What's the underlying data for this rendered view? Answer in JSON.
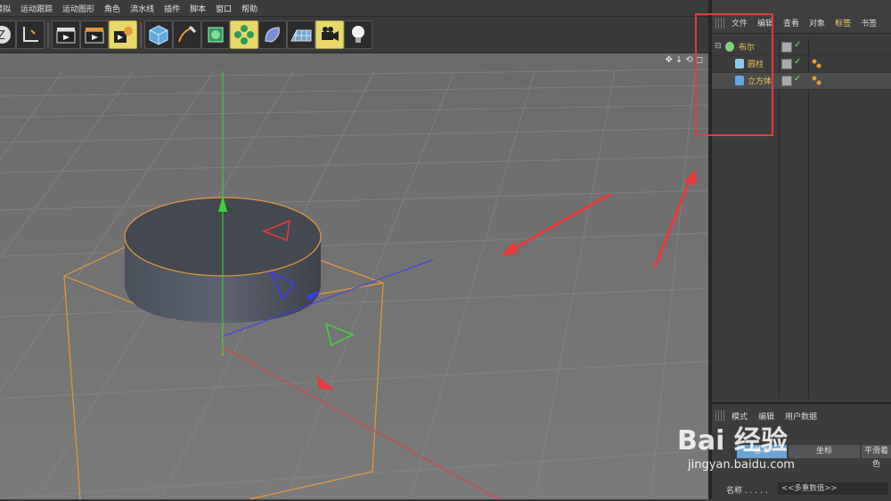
{
  "menubar": {
    "items": [
      "模拟",
      "运动跟踪",
      "运动图形",
      "角色",
      "流水线",
      "插件",
      "脚本",
      "窗口",
      "帮助"
    ]
  },
  "toolbar": {
    "buttons": [
      {
        "icon": "undo-z-icon"
      },
      {
        "icon": "axis-icon"
      },
      {
        "icon": "cube-edit-icon"
      },
      {
        "icon": "render-clapper-icon"
      },
      {
        "icon": "render-active-icon"
      },
      {
        "icon": "render-settings-icon"
      },
      {
        "icon": "cube-primitive-icon"
      },
      {
        "icon": "pen-spline-icon"
      },
      {
        "icon": "subdivision-icon"
      },
      {
        "icon": "array-cloner-icon"
      },
      {
        "icon": "deformer-icon"
      },
      {
        "icon": "floor-plane-icon"
      },
      {
        "icon": "camera-icon"
      },
      {
        "icon": "light-bulb-icon"
      }
    ]
  },
  "viewport": {
    "nav_icons": [
      "✥",
      "↓",
      "⟲",
      "◻"
    ]
  },
  "object_manager": {
    "menu": [
      "文件",
      "编辑",
      "查看",
      "对象",
      "标签",
      "书签"
    ],
    "active_menu": "标签",
    "objects": [
      {
        "name": "布尔",
        "depth": 0,
        "icon_color": "#7fd37f",
        "tags": false
      },
      {
        "name": "圆柱",
        "depth": 1,
        "icon_color": "#8ec8f0",
        "tags": true
      },
      {
        "name": "立方体",
        "depth": 1,
        "icon_color": "#5fa8e0",
        "tags": true,
        "selected": true
      }
    ]
  },
  "attributes": {
    "menu": [
      "模式",
      "编辑",
      "用户数据"
    ],
    "tabs": [
      "基本",
      "坐标",
      "平滑着色"
    ],
    "name_label": "名称 . . . . .",
    "name_value": "<<多重数值>>"
  },
  "watermark": {
    "brand": "Bai 经验",
    "url": "jingyan.baidu.com"
  },
  "colors": {
    "accent": "#f0d870",
    "highlight_box": "#e03c3c",
    "selection_orange": "#e8983a"
  }
}
